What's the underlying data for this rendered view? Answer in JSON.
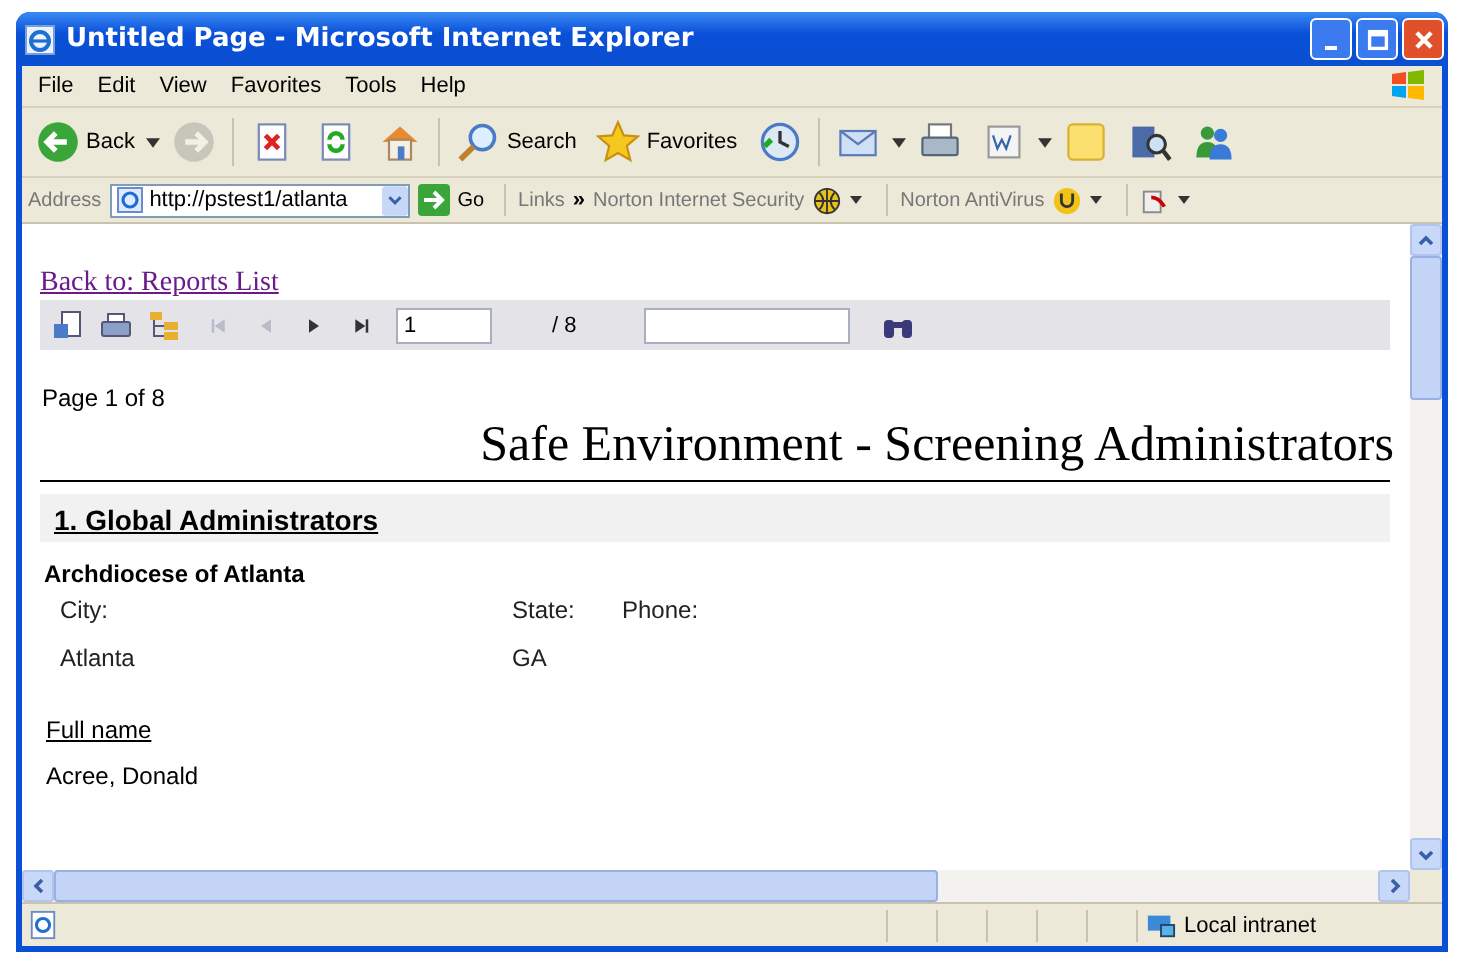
{
  "window": {
    "title": "Untitled Page - Microsoft Internet Explorer"
  },
  "menu": [
    "File",
    "Edit",
    "View",
    "Favorites",
    "Tools",
    "Help"
  ],
  "toolbar": [
    {
      "kind": "back",
      "label": "Back",
      "disabled": false
    },
    {
      "kind": "forward",
      "disabled": true
    },
    {
      "kind": "stop",
      "disabled": false
    },
    {
      "kind": "refresh",
      "disabled": false
    },
    {
      "kind": "home",
      "disabled": false
    },
    {
      "kind": "search",
      "label": "Search",
      "disabled": false
    },
    {
      "kind": "favorites",
      "label": "Favorites",
      "disabled": false
    },
    {
      "kind": "history",
      "disabled": false
    },
    {
      "kind": "mail",
      "disabled": false
    },
    {
      "kind": "print",
      "disabled": false
    },
    {
      "kind": "word",
      "disabled": false
    },
    {
      "kind": "note",
      "disabled": false
    },
    {
      "kind": "research",
      "disabled": false
    },
    {
      "kind": "messenger",
      "disabled": false
    }
  ],
  "address_bar": {
    "label": "Address",
    "url": "http://pstest1/atlanta",
    "go": "Go",
    "links": "Links",
    "links_more": "»",
    "norton_security": "Norton Internet Security",
    "norton_antivirus": "Norton AntiVirus"
  },
  "report": {
    "back_link": "Back to: Reports List",
    "nav": [
      {
        "kind": "first",
        "disabled": true
      },
      {
        "kind": "prev",
        "disabled": true
      },
      {
        "kind": "next",
        "disabled": false
      },
      {
        "kind": "last",
        "disabled": false
      }
    ],
    "page_input": "1",
    "page_total": "/ 8",
    "page_label": "Page 1 of 8",
    "title": "Safe Environment - Screening Administrators",
    "section": "1. Global Administrators",
    "organization": "Archdiocese of Atlanta",
    "fields": [
      {
        "label": "City:",
        "value": "Atlanta"
      },
      {
        "label": "State:",
        "value": "GA"
      },
      {
        "label": "Phone:"
      }
    ],
    "name_header": "Full name",
    "names": [
      "Acree, Donald"
    ]
  },
  "status_bar": {
    "zone": "Local intranet"
  }
}
